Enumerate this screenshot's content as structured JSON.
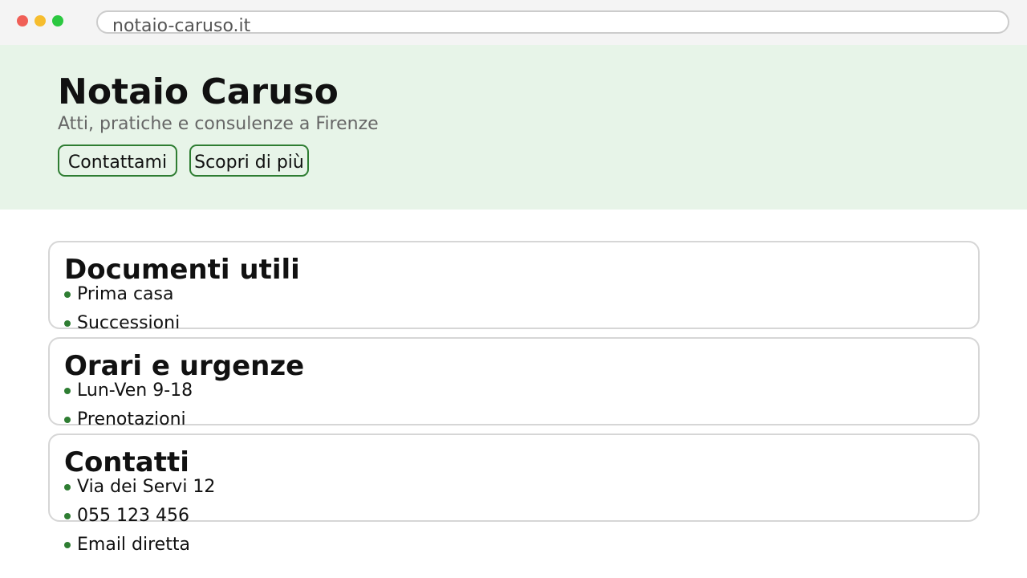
{
  "browser": {
    "url": "notaio-caruso.it"
  },
  "hero": {
    "title": "Notaio Caruso",
    "subtitle": "Atti, pratiche e consulenze a Firenze",
    "buttons": {
      "contact": "Contattami",
      "more": "Scopri di più"
    }
  },
  "cards": [
    {
      "title": "Documenti utili",
      "items": [
        "Prima casa",
        "Successioni"
      ]
    },
    {
      "title": "Orari e urgenze",
      "items": [
        "Lun-Ven 9-18",
        "Prenotazioni"
      ]
    },
    {
      "title": "Contatti",
      "items": [
        "Via dei Servi 12",
        "055 123 456",
        "Email diretta"
      ]
    }
  ],
  "colors": {
    "accent": "#2e7d32",
    "hero_background": "#e7f4e8"
  }
}
